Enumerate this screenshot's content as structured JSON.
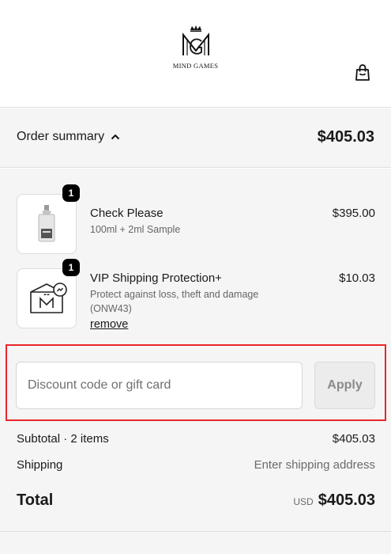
{
  "brand": {
    "name": "MIND GAMES",
    "logo_icon": "mind-games-crown-logo"
  },
  "header": {
    "cart_icon": "shopping-bag-icon"
  },
  "summary_bar": {
    "label": "Order summary",
    "toggle_icon": "chevron-up-icon",
    "total": "$405.03"
  },
  "items": [
    {
      "name": "Check Please",
      "variant": "100ml + 2ml Sample",
      "price": "$395.00",
      "quantity": "1",
      "thumb_icon": "perfume-bottle-icon"
    },
    {
      "name": "VIP Shipping Protection+",
      "description": "Protect against loss, theft and damage",
      "code": "(ONW43)",
      "price": "$10.03",
      "quantity": "1",
      "action": "remove",
      "thumb_icon": "shipping-box-icon"
    }
  ],
  "discount": {
    "placeholder": "Discount code or gift card",
    "value": "",
    "apply_label": "Apply",
    "highlight_color": "#e8262a"
  },
  "totals": {
    "subtotal_label": "Subtotal · 2 items",
    "subtotal_value": "$405.03",
    "shipping_label": "Shipping",
    "shipping_value": "Enter shipping address",
    "total_label": "Total",
    "currency": "USD",
    "total_value": "$405.03"
  }
}
